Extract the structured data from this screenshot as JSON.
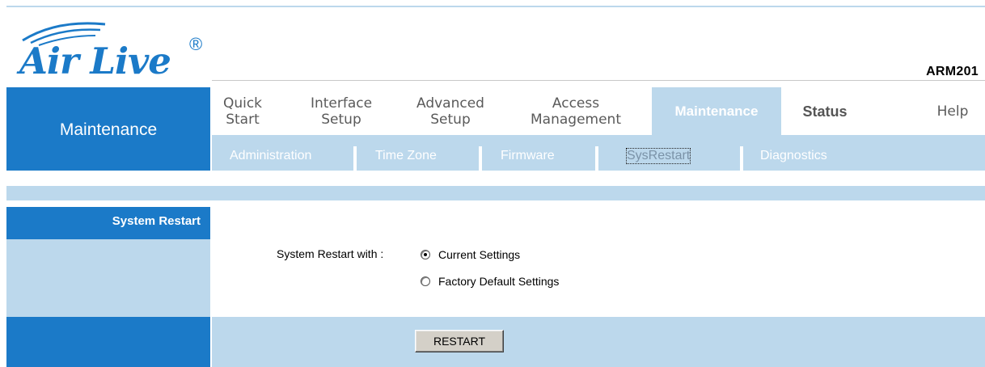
{
  "brand": {
    "logo_text": "Air Live",
    "registered": "®",
    "model": "ARM201"
  },
  "section_title": "Maintenance",
  "main_menu": [
    {
      "label": "Quick\nStart",
      "active": false
    },
    {
      "label": "Interface\nSetup",
      "active": false
    },
    {
      "label": "Advanced\nSetup",
      "active": false
    },
    {
      "label": "Access\nManagement",
      "active": false
    },
    {
      "label": "Maintenance",
      "active": true
    },
    {
      "label": "Status",
      "active": false
    },
    {
      "label": "Help",
      "active": false
    }
  ],
  "sub_menu": [
    {
      "label": "Administration",
      "selected": false
    },
    {
      "label": "Time Zone",
      "selected": false
    },
    {
      "label": "Firmware",
      "selected": false
    },
    {
      "label": "SysRestart",
      "selected": true
    },
    {
      "label": "Diagnostics",
      "selected": false
    }
  ],
  "page": {
    "section_label": "System Restart",
    "field_label": "System Restart with :",
    "options": [
      {
        "label": "Current Settings",
        "checked": true
      },
      {
        "label": "Factory Default Settings",
        "checked": false
      }
    ],
    "restart_button": "RESTART"
  },
  "colors": {
    "brand_blue": "#1b7ac8",
    "light_blue": "#bcd8ec",
    "button_gray": "#d4d0c8"
  },
  "icons": {
    "logo_swoosh": "wifi-arcs-icon"
  }
}
